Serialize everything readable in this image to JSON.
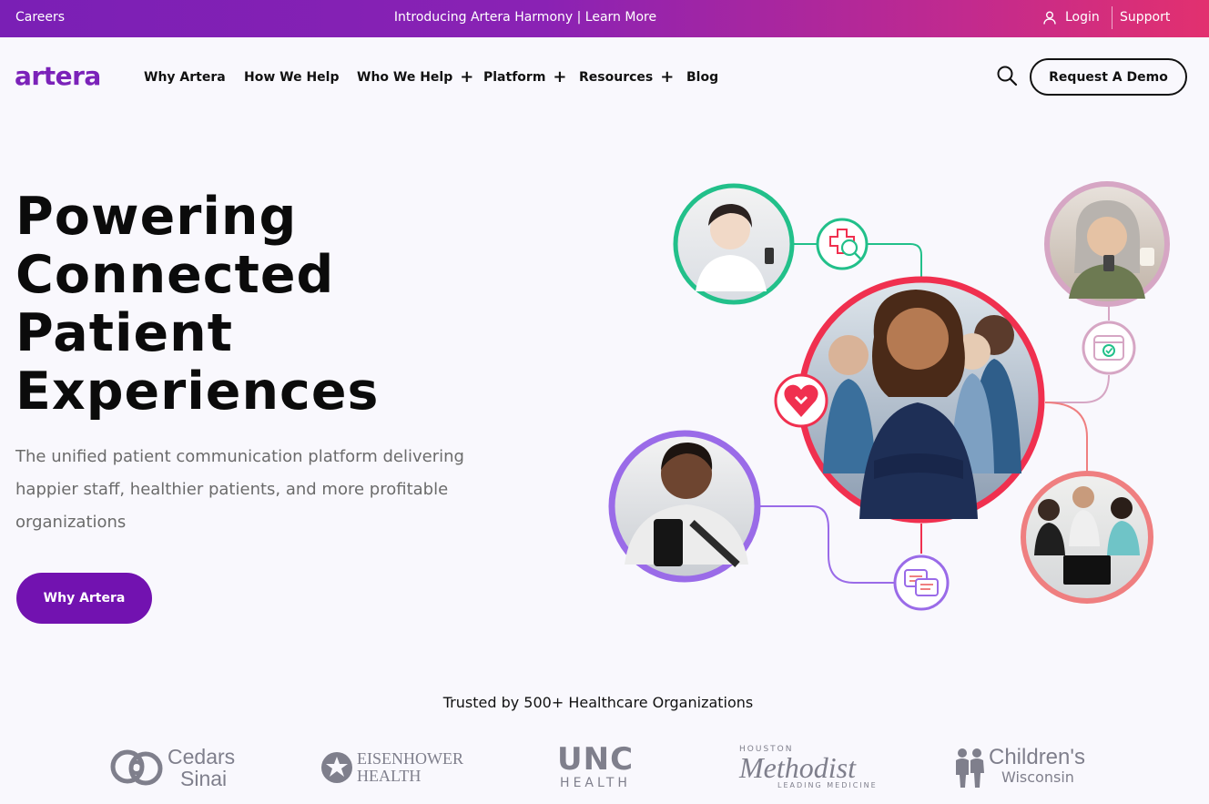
{
  "topbar": {
    "careers": "Careers",
    "announcement": "Introducing Artera Harmony | Learn More",
    "login": "Login",
    "support": "Support"
  },
  "nav": {
    "logo": "artera",
    "items": [
      {
        "label": "Why Artera",
        "has_submenu": false
      },
      {
        "label": "How We Help",
        "has_submenu": false
      },
      {
        "label": "Who We Help",
        "has_submenu": true
      },
      {
        "label": "Platform",
        "has_submenu": true
      },
      {
        "label": "Resources",
        "has_submenu": true
      },
      {
        "label": "Blog",
        "has_submenu": false
      }
    ],
    "demo_button": "Request A Demo"
  },
  "hero": {
    "title_lines": [
      "Powering",
      "Connected",
      "Patient",
      "Experiences"
    ],
    "subtitle": "The unified patient communication platform delivering happier staff, healthier patients, and more profitable organizations",
    "cta": "Why Artera"
  },
  "trusted": {
    "heading": "Trusted by 500+ Healthcare Organizations",
    "logos": [
      {
        "name": "Cedars Sinai",
        "line1": "Cedars",
        "line2": "Sinai"
      },
      {
        "name": "Eisenhower Health",
        "line1": "EISENHOWER",
        "line2": "HEALTH"
      },
      {
        "name": "UNC Health",
        "line1": "UNC",
        "line2": "HEALTH"
      },
      {
        "name": "Houston Methodist",
        "line0": "HOUSTON",
        "line1": "Methodist",
        "line2": "LEADING MEDICINE"
      },
      {
        "name": "Children's Wisconsin",
        "line1": "Children's",
        "line2": "Wisconsin"
      }
    ]
  },
  "colors": {
    "brand_purple": "#7212b0",
    "gradient_end": "#e2306f",
    "ring_green": "#22c08a",
    "ring_red": "#f0304f",
    "ring_purple": "#9a6be8",
    "ring_pink": "#d6a6c4",
    "ring_salmon": "#ef7f80"
  },
  "icons": [
    "user-icon",
    "search-icon",
    "plus-icon",
    "medical-search-icon",
    "calendar-check-icon",
    "heart-logo-icon",
    "chat-bubbles-icon"
  ]
}
